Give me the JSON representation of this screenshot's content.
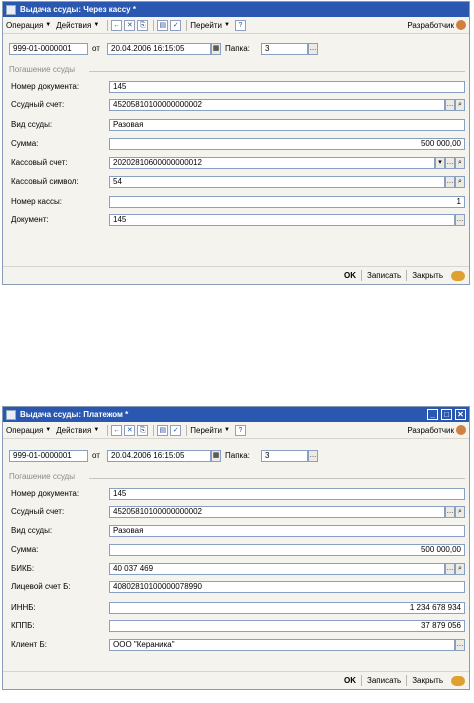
{
  "windows": [
    {
      "title": "Выдача ссуды: Через кассу *",
      "toolbar": {
        "operation": "Операция",
        "actions": "Действия",
        "goto": "Перейти",
        "help": "?",
        "developer": "Разработчик"
      },
      "header": {
        "number": "999-01-0000001",
        "from_label": "от",
        "date": "20.04.2006 16:15:05",
        "folder_label": "Папка:",
        "folder": "3"
      },
      "section_title": "Погашение ссуды",
      "fields": {
        "doc_number_label": "Номер документа:",
        "doc_number": "145",
        "loan_account_label": "Ссудный счет:",
        "loan_account": "45205810100000000002",
        "loan_type_label": "Вид ссуды:",
        "loan_type": "Разовая",
        "amount_label": "Сумма:",
        "amount": "500 000,00",
        "cash_account_label": "Кассовый счет:",
        "cash_account": "20202810600000000012",
        "cash_symbol_label": "Кассовый символ:",
        "cash_symbol": "54",
        "cash_desk_label": "Номер кассы:",
        "cash_desk": "1",
        "document_label": "Документ:",
        "document": "145"
      },
      "footer": {
        "ok": "OK",
        "save": "Записать",
        "close": "Закрыть"
      }
    },
    {
      "title": "Выдача ссуды: Платежом *",
      "toolbar": {
        "operation": "Операция",
        "actions": "Действия",
        "goto": "Перейти",
        "help": "?",
        "developer": "Разработчик"
      },
      "header": {
        "number": "999-01-0000001",
        "from_label": "от",
        "date": "20.04.2006 16:15:05",
        "folder_label": "Папка:",
        "folder": "3"
      },
      "section_title": "Погашение ссуды",
      "fields": {
        "doc_number_label": "Номер документа:",
        "doc_number": "145",
        "loan_account_label": "Ссудный счет:",
        "loan_account": "45205810100000000002",
        "loan_type_label": "Вид ссуды:",
        "loan_type": "Разовая",
        "amount_label": "Сумма:",
        "amount": "500 000,00",
        "bik_label": "БИКБ:",
        "bik": "40 037 469",
        "personal_account_label": "Лицевой счет Б:",
        "personal_account": "40802810100000078990",
        "inn_label": "ИННБ:",
        "inn": "1 234 678 934",
        "kpp_label": "КППБ:",
        "kpp": "37 879 056",
        "client_label": "Клиент Б:",
        "client": "ООО \"Кераника\""
      },
      "footer": {
        "ok": "OK",
        "save": "Записать",
        "close": "Закрыть"
      }
    }
  ]
}
